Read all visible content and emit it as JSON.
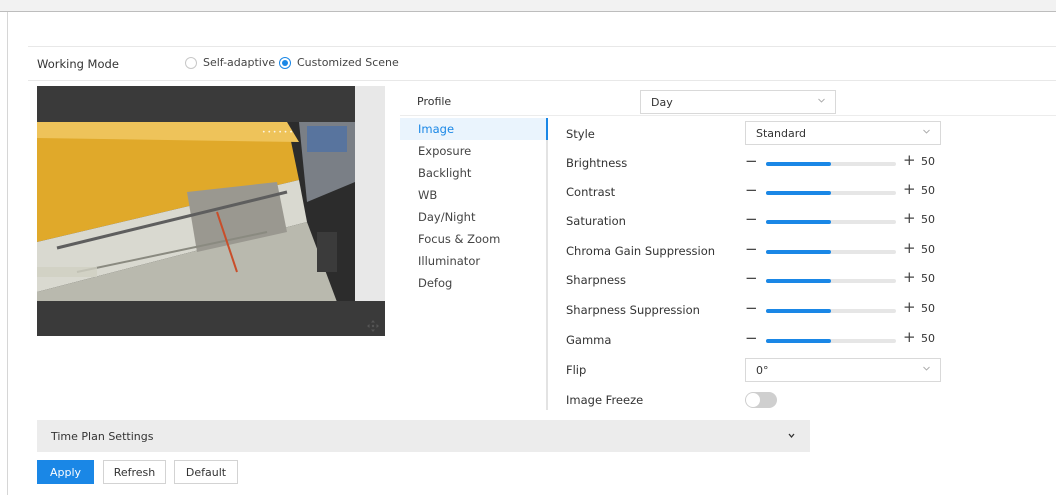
{
  "working_mode": {
    "label": "Working Mode",
    "options": [
      {
        "label": "Self-adaptive",
        "checked": false
      },
      {
        "label": "Customized Scene",
        "checked": true
      }
    ]
  },
  "preview": {
    "move_icon": "move-arrows-icon"
  },
  "profile": {
    "label": "Profile",
    "value": "Day"
  },
  "tabs": [
    "Image",
    "Exposure",
    "Backlight",
    "WB",
    "Day/Night",
    "Focus & Zoom",
    "Illuminator",
    "Defog"
  ],
  "active_tab": "Image",
  "settings": {
    "style": {
      "label": "Style",
      "value": "Standard"
    },
    "sliders": [
      {
        "label": "Brightness",
        "value": "50",
        "fraction": 0.5
      },
      {
        "label": "Contrast",
        "value": "50",
        "fraction": 0.5
      },
      {
        "label": "Saturation",
        "value": "50",
        "fraction": 0.5
      },
      {
        "label": "Chroma Gain Suppression",
        "value": "50",
        "fraction": 0.5
      },
      {
        "label": "Sharpness",
        "value": "50",
        "fraction": 0.5
      },
      {
        "label": "Sharpness Suppression",
        "value": "50",
        "fraction": 0.5
      },
      {
        "label": "Gamma",
        "value": "50",
        "fraction": 0.5
      }
    ],
    "flip": {
      "label": "Flip",
      "value": "0°"
    },
    "image_freeze": {
      "label": "Image Freeze",
      "on": false
    }
  },
  "slider_minus": "−",
  "slider_plus": "+",
  "time_plan": {
    "label": "Time Plan Settings"
  },
  "buttons": {
    "apply": "Apply",
    "refresh": "Refresh",
    "default": "Default"
  },
  "colors": {
    "accent": "#1a87e6",
    "panel": "#ececec"
  }
}
